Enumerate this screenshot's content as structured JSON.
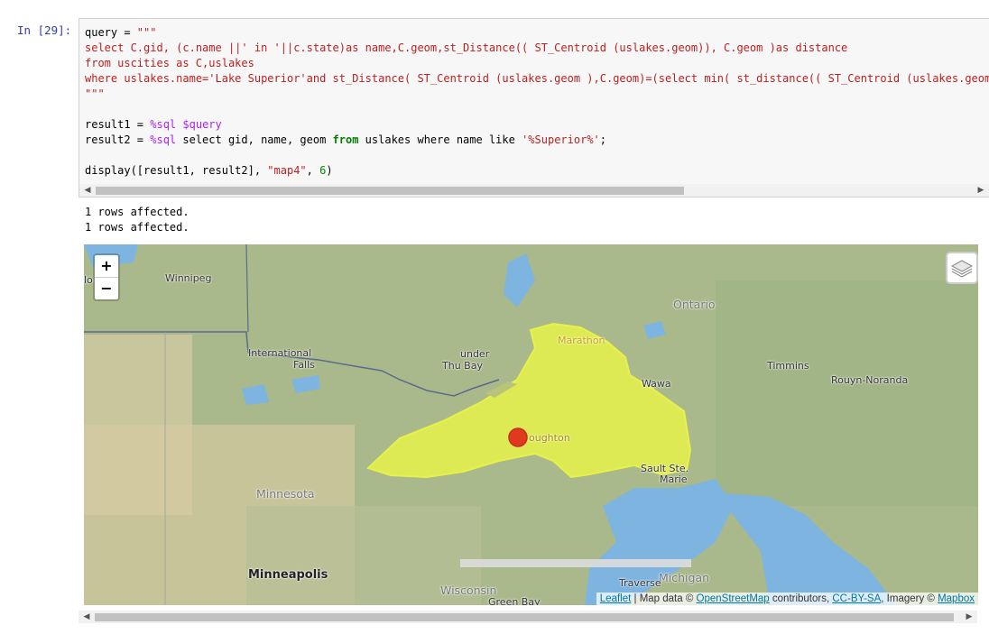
{
  "cell": {
    "prompt": "In  [29]:",
    "code": {
      "l1_a": "query = ",
      "l1_b": "\"\"\"",
      "l2": "select C.gid, (c.name ||' in '||c.state)as name,C.geom,st_Distance(( ST_Centroid (uslakes.geom)), C.geom )as distance",
      "l3": "from uscities as C,uslakes",
      "l4": "where uslakes.name='Lake Superior'and st_Distance( ST_Centroid (uslakes.geom ),C.geom)=(select min( st_distance(( ST_Centroid (uslakes.geom)),u",
      "l5": "\"\"\"",
      "l7_a": "result1 = ",
      "l7_b": "%sql",
      "l7_c": " ",
      "l7_d": "$query",
      "l8_a": "result2 = ",
      "l8_b": "%sql",
      "l8_c": " select gid, name, geom ",
      "l8_d": "from",
      "l8_e": " uslakes where name like ",
      "l8_f": "'%Superior%'",
      "l8_g": ";",
      "l10_a": "display([result1, result2], ",
      "l10_b": "\"map4\"",
      "l10_c": ", ",
      "l10_d": "6",
      "l10_e": ")"
    }
  },
  "output": {
    "line1": "1 rows affected.",
    "line2": "1 rows affected."
  },
  "map": {
    "zoom_in": "+",
    "zoom_out": "−",
    "labels": {
      "winnipeg": "Winnipeg",
      "ontario": "Ontario",
      "marathon": "Marathon",
      "international_falls_1": "International",
      "international_falls_2": "Falls",
      "thunder_bay_1": "under",
      "thunder_bay_2": "Thu  Bay",
      "timmins": "Timmins",
      "rouyn": "Rouyn-Noranda",
      "wawa": "Wawa",
      "houghton": "oughton",
      "sault_1": "Sault Ste.",
      "sault_2": "Marie",
      "minnesota": "Minnesota",
      "minneapolis": "Minneapolis",
      "wisconsin": "Wisconsin",
      "michigan": "Michigan",
      "traverse": "Traverse",
      "green_bay": "Green Bay",
      "lo": "lo"
    },
    "attribution": {
      "leaflet": "Leaflet",
      "sep1": " | Map data © ",
      "osm": "OpenStreetMap",
      "sep2": " contributors, ",
      "ccbysa": "CC-BY-SA",
      "sep3": ", Imagery © ",
      "mapbox": "Mapbox"
    },
    "colors": {
      "lake_fill": "#e6f24a",
      "marker": "#e03a1e",
      "water": "#7db4e0"
    }
  }
}
